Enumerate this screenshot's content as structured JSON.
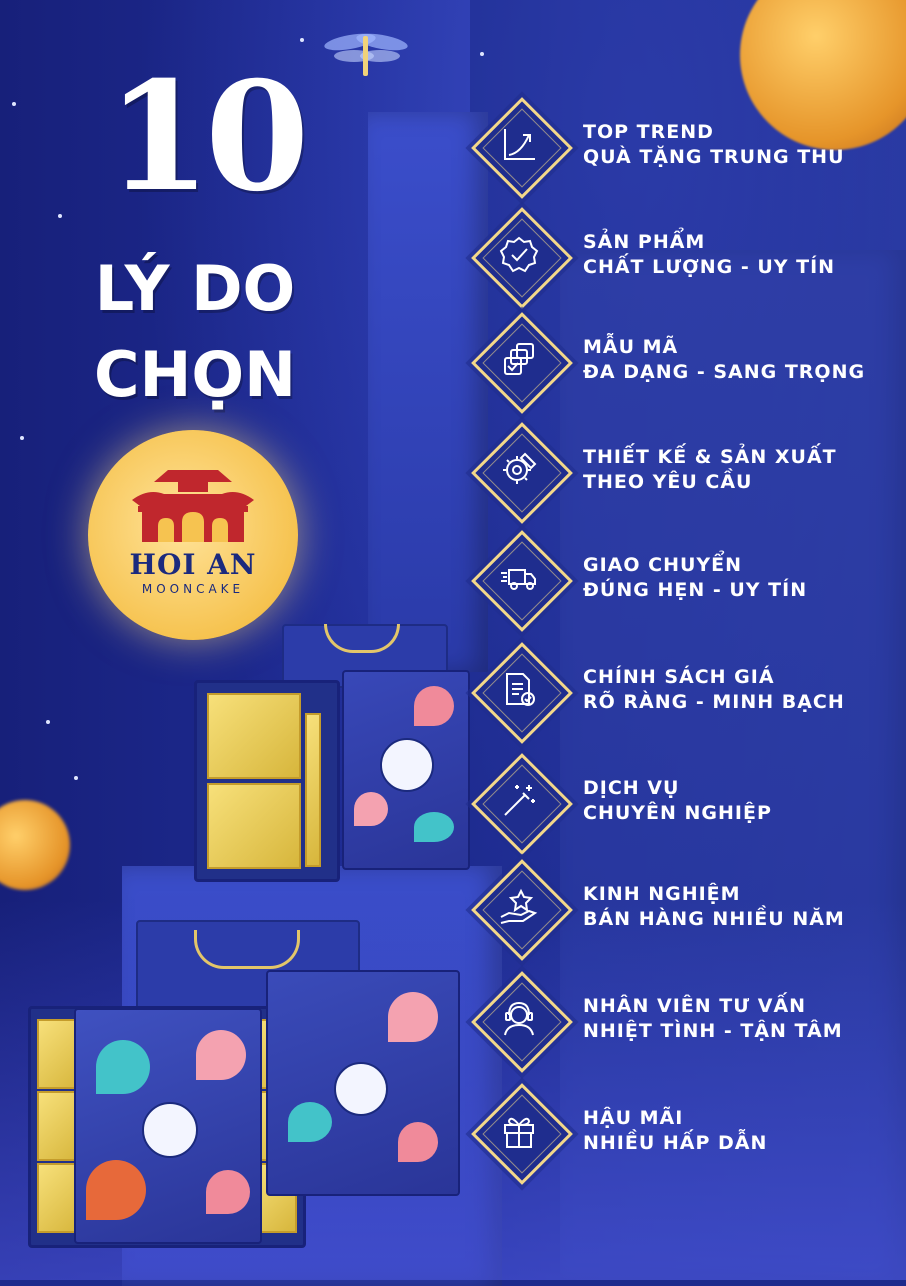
{
  "headline": {
    "number": "10",
    "line1": "LÝ DO",
    "line2": "CHỌN"
  },
  "logo": {
    "name": "HOI AN",
    "subtitle": "MOONCAKE"
  },
  "colors": {
    "background": "#1d2a8c",
    "accent_gold": "#f3d88a",
    "moon": "#f6c350",
    "logo_red": "#c0272d",
    "logo_navy": "#1b2a7e"
  },
  "reasons": [
    {
      "icon": "trend-chart-icon",
      "line1": "TOP TREND",
      "line2": "QUÀ TẶNG TRUNG THU"
    },
    {
      "icon": "quality-badge-icon",
      "line1": "SẢN PHẨM",
      "line2": "CHẤT LƯỢNG - UY TÍN"
    },
    {
      "icon": "stacked-cards-icon",
      "line1": "MẪU MÃ",
      "line2": "ĐA DẠNG - SANG TRỌNG"
    },
    {
      "icon": "design-gear-icon",
      "line1": "THIẾT KẾ & SẢN XUẤT",
      "line2": "THEO YÊU CẦU"
    },
    {
      "icon": "delivery-truck-icon",
      "line1": "GIAO CHUYỂN",
      "line2": "ĐÚNG HẸN - UY TÍN"
    },
    {
      "icon": "price-document-icon",
      "line1": "CHÍNH SÁCH GIÁ",
      "line2": "RÕ RÀNG - MINH BẠCH"
    },
    {
      "icon": "magic-wand-icon",
      "line1": "DỊCH VỤ",
      "line2": "CHUYÊN NGHIỆP"
    },
    {
      "icon": "hand-star-icon",
      "line1": "KINH NGHIỆM",
      "line2": "BÁN HÀNG NHIỀU NĂM"
    },
    {
      "icon": "headset-agent-icon",
      "line1": "NHÂN VIÊN TƯ VẤN",
      "line2": "NHIỆT TÌNH - TẬN TÂM"
    },
    {
      "icon": "gift-box-icon",
      "line1": "HẬU MÃI",
      "line2": "NHIỀU HẤP DẪN"
    }
  ]
}
